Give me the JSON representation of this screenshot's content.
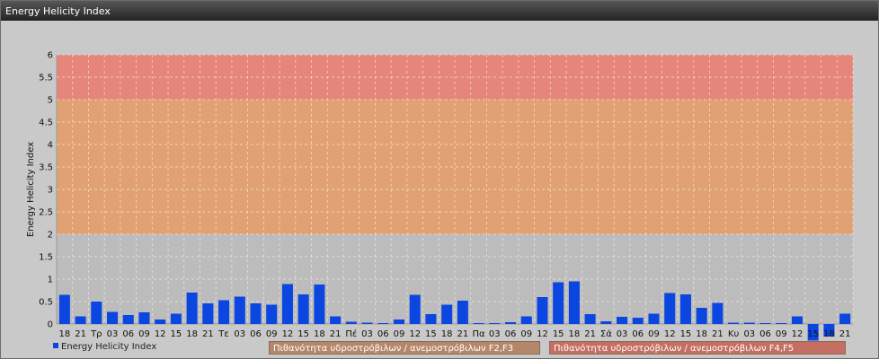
{
  "window": {
    "title": "Energy Helicity Index"
  },
  "colors": {
    "low_zone": "#bcbcbc",
    "mid_zone": "#e2a172",
    "high_zone": "#e6857a",
    "bar": "#0c46e0",
    "grid": "#f4f4f4"
  },
  "chart_data": {
    "type": "bar",
    "ylabel": "Energy Helicity Index",
    "ylim": [
      0,
      6
    ],
    "yticks": [
      "0",
      "0.5",
      "1",
      "1.5",
      "2",
      "2.5",
      "3",
      "3.5",
      "4",
      "4.5",
      "5",
      "5.5",
      "6"
    ],
    "grid": true,
    "bands": [
      {
        "from": 0,
        "to": 2,
        "color": "#bcbcbc"
      },
      {
        "from": 2,
        "to": 5,
        "color": "#e2a172"
      },
      {
        "from": 5,
        "to": 6,
        "color": "#e6857a"
      }
    ],
    "categories": [
      "18",
      "21",
      "Τρ",
      "03",
      "06",
      "09",
      "12",
      "15",
      "18",
      "21",
      "Τε",
      "03",
      "06",
      "09",
      "12",
      "15",
      "18",
      "21",
      "Πέ",
      "03",
      "06",
      "09",
      "12",
      "15",
      "18",
      "21",
      "Πα",
      "03",
      "06",
      "09",
      "12",
      "15",
      "18",
      "21",
      "Σά",
      "03",
      "06",
      "09",
      "12",
      "15",
      "18",
      "21",
      "Κυ",
      "03",
      "06",
      "09",
      "12",
      "15",
      "18",
      "21"
    ],
    "series": [
      {
        "name": "Energy Helicity Index",
        "values": [
          0.65,
          0.17,
          0.5,
          0.27,
          0.2,
          0.26,
          0.1,
          0.23,
          0.7,
          0.46,
          0.53,
          0.61,
          0.46,
          0.43,
          0.89,
          0.66,
          0.88,
          0.17,
          0.05,
          0.03,
          0.02,
          0.1,
          0.65,
          0.22,
          0.43,
          0.52,
          0.02,
          0.02,
          0.04,
          0.17,
          0.6,
          0.93,
          0.95,
          0.22,
          0.06,
          0.16,
          0.14,
          0.23,
          0.69,
          0.66,
          0.36,
          0.47,
          0.03,
          0.03,
          0.02,
          0.02,
          0.17,
          -0.37,
          -0.28,
          0.23
        ]
      }
    ]
  },
  "legend": {
    "series_label": "Energy Helicity Index",
    "prob_f2f3": "Πιθανότητα υδροστρόβιλων / ανεμοστρόβιλων F2,F3",
    "prob_f4f5": "Πιθανότητα υδροστρόβιλων / ανεμοστρόβιλων F4,F5"
  }
}
